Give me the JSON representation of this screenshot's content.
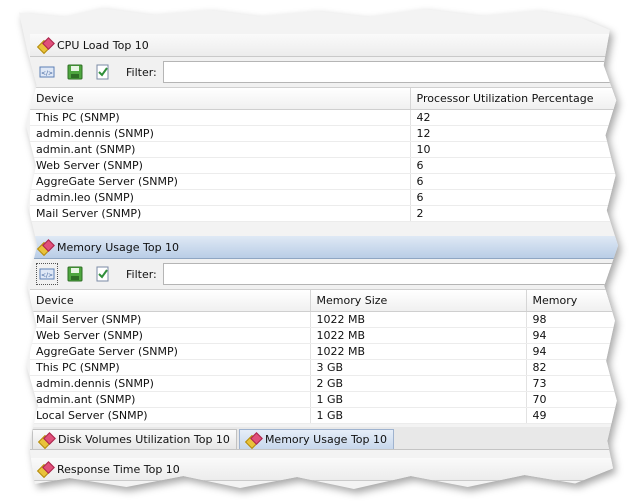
{
  "cpu_panel": {
    "title": "CPU Load Top 10",
    "filter_label": "Filter:",
    "filter_value": "",
    "columns": [
      "Device",
      "Processor Utilization Percentage"
    ],
    "rows": [
      [
        "This PC (SNMP)",
        "42"
      ],
      [
        "admin.dennis (SNMP)",
        "12"
      ],
      [
        "admin.ant (SNMP)",
        "10"
      ],
      [
        "Web Server (SNMP)",
        "6"
      ],
      [
        "AggreGate Server (SNMP)",
        "6"
      ],
      [
        "admin.leo (SNMP)",
        "6"
      ],
      [
        "Mail Server (SNMP)",
        "2"
      ]
    ]
  },
  "memory_panel": {
    "title": "Memory Usage Top 10",
    "filter_label": "Filter:",
    "filter_value": "",
    "columns": [
      "Device",
      "Memory Size",
      "Memory"
    ],
    "rows": [
      [
        "Mail Server (SNMP)",
        "1022 MB",
        "98"
      ],
      [
        "Web Server (SNMP)",
        "1022 MB",
        "94"
      ],
      [
        "AggreGate Server (SNMP)",
        "1022 MB",
        "94"
      ],
      [
        "This PC (SNMP)",
        "3 GB",
        "82"
      ],
      [
        "admin.dennis (SNMP)",
        "2 GB",
        "73"
      ],
      [
        "admin.ant (SNMP)",
        "1 GB",
        "70"
      ],
      [
        "Local Server (SNMP)",
        "1 GB",
        "49"
      ]
    ]
  },
  "tabs": [
    {
      "label": "Disk Volumes Utilization Top 10",
      "active": false
    },
    {
      "label": "Memory Usage Top 10",
      "active": true
    }
  ],
  "response_panel": {
    "title": "Response Time Top 10"
  },
  "colors": {
    "active_title": "#b9cde6",
    "icon_yellow": "#e9c23a",
    "icon_pink": "#e0507a"
  }
}
